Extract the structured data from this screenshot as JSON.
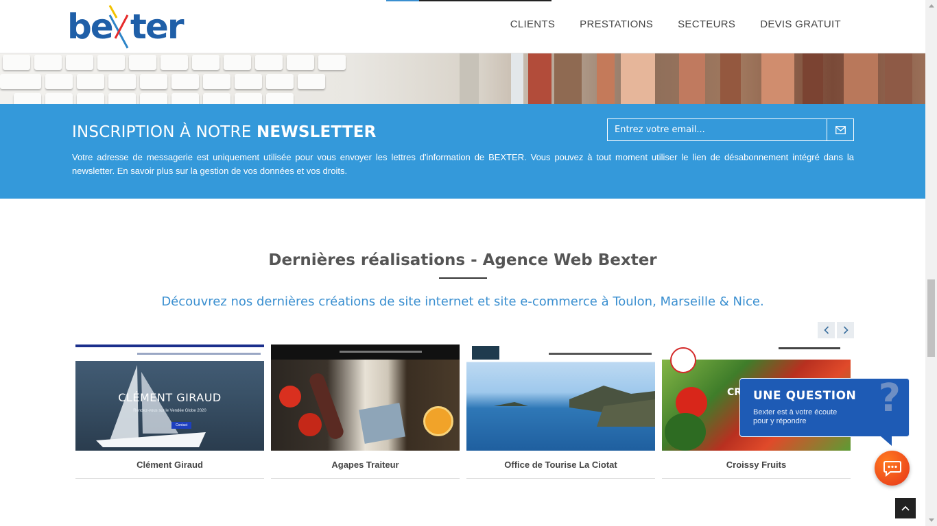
{
  "brand": {
    "name": "bexter"
  },
  "nav": {
    "items": [
      "CLIENTS",
      "PRESTATIONS",
      "SECTEURS",
      "DEVIS GRATUIT"
    ]
  },
  "newsletter": {
    "title_prefix": "INSCRIPTION À NOTRE ",
    "title_bold": "NEWSLETTER",
    "placeholder": "Entrez votre email...",
    "text": "Votre adresse de messagerie est uniquement utilisée pour vous envoyer les lettres d'information de BEXTER. Vous pouvez à tout moment utiliser le lien de désabonnement intégré dans la newsletter. En savoir plus sur la gestion de vos données et vos droits.",
    "submit_icon": "envelope-icon"
  },
  "realisations": {
    "title": "Dernières réalisations - Agence Web Bexter",
    "subtitle": "Découvrez nos dernières créations de site internet et site e-commerce à Toulon, Marseille & Nice.",
    "cards": [
      {
        "caption": "Clément Giraud",
        "overlay": "CLÉMENT GIRAUD",
        "overlay_sub": "Rendez-vous sur le Vendée Globe 2020",
        "overlay_btn": "Contact"
      },
      {
        "caption": "Agapes Traiteur"
      },
      {
        "caption": "Office de Tourise La Ciotat"
      },
      {
        "caption": "Croissy Fruits",
        "overlay": "CRO"
      }
    ]
  },
  "chat": {
    "title": "UNE QUESTION",
    "text": "Bexter est à votre écoute pour y répondre",
    "qmark": "?"
  },
  "colors": {
    "accent_blue": "#3499da",
    "chat_blue": "#1e5bb5",
    "chat_orange": "#e6351a"
  }
}
